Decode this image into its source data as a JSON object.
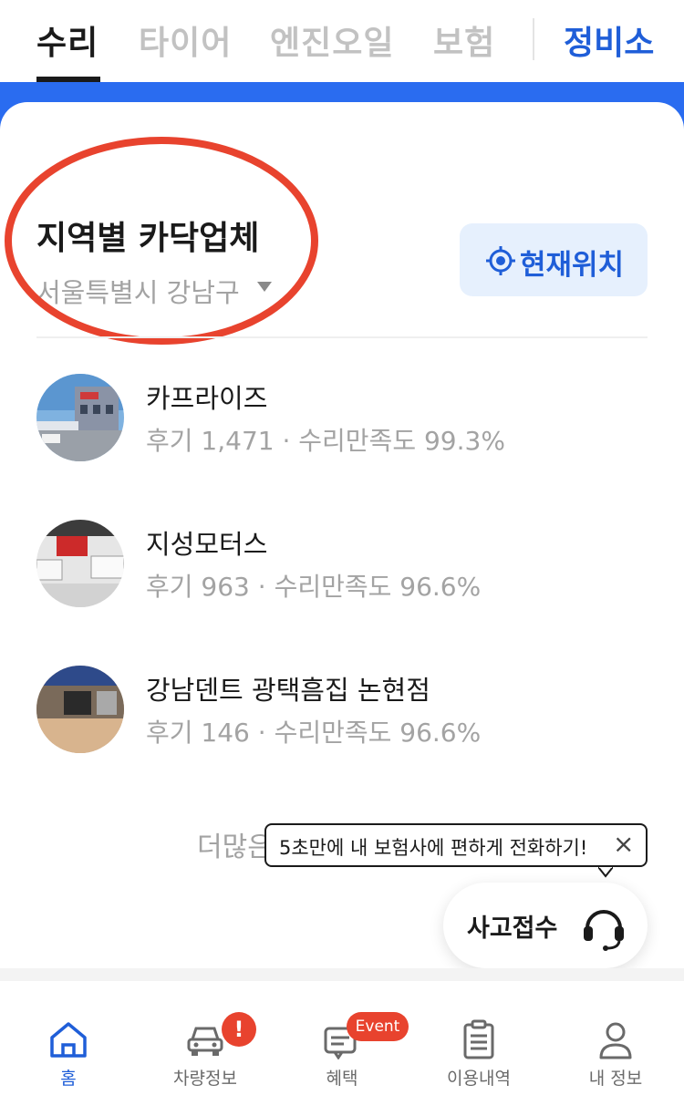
{
  "tabs": [
    {
      "label": "수리",
      "active": true
    },
    {
      "label": "타이어",
      "active": false
    },
    {
      "label": "엔진오일",
      "active": false
    },
    {
      "label": "보험",
      "active": false
    }
  ],
  "shop_tab_label": "정비소",
  "region": {
    "title": "지역별 카닥업체",
    "selected": "서울특별시 강남구"
  },
  "locate_button": {
    "label": "현재위치",
    "icon": "target-icon"
  },
  "shops": [
    {
      "name": "카프라이즈",
      "stats": "후기 1,471 · 수리만족도 99.3%"
    },
    {
      "name": "지성모터스",
      "stats": "후기 963 · 수리만족도 96.6%"
    },
    {
      "name": "강남덴트 광택흠집 논현점",
      "stats": "후기 146 · 수리만족도 96.6%"
    }
  ],
  "more_label": "더많은",
  "tooltip": {
    "text": "5초만에 내 보험사에 편하게 전화하기!",
    "close": "×"
  },
  "fab": {
    "label": "사고접수",
    "icon": "headset-icon"
  },
  "bottom_nav": [
    {
      "label": "홈",
      "icon": "home-icon",
      "active": true
    },
    {
      "label": "차량정보",
      "icon": "car-icon",
      "badge": "!"
    },
    {
      "label": "혜택",
      "icon": "benefit-icon",
      "badge": "Event"
    },
    {
      "label": "이용내역",
      "icon": "clipboard-icon"
    },
    {
      "label": "내 정보",
      "icon": "person-icon"
    }
  ],
  "colors": {
    "accent_blue": "#1f5ed8",
    "band_blue": "#2a6cf0",
    "annotation_red": "#e8432e",
    "badge_red": "#e8432e"
  }
}
